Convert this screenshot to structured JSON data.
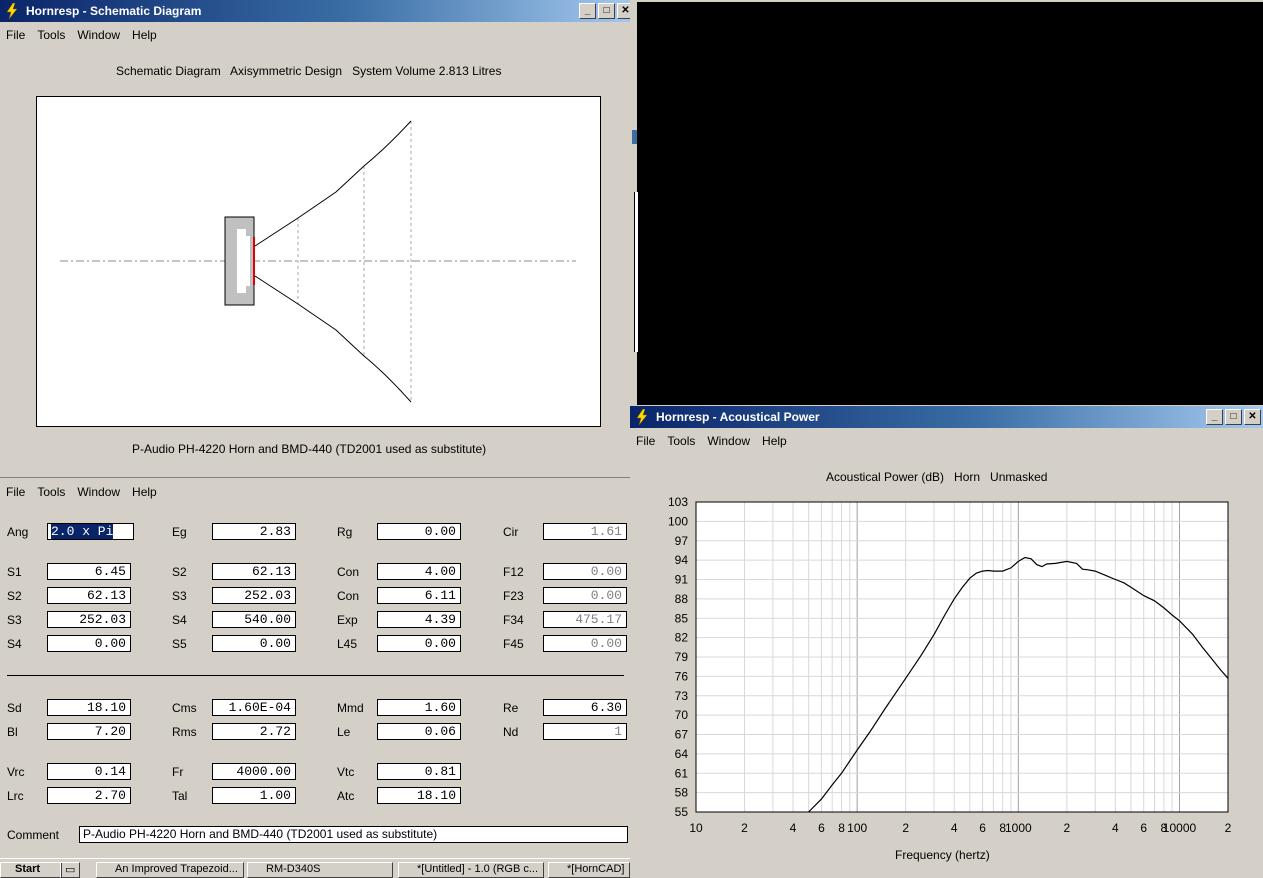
{
  "schematic_window": {
    "title": "Hornresp - Schematic Diagram",
    "menu": [
      "File",
      "Tools",
      "Window",
      "Help"
    ],
    "heading": "Schematic Diagram   Axisymmetric Design   System Volume 2.813 Litres",
    "caption": "P-Audio PH-4220 Horn and BMD-440 (TD2001 used as substitute)"
  },
  "param_window": {
    "menu": [
      "File",
      "Tools",
      "Window",
      "Help"
    ],
    "rows": [
      {
        "label": "Ang",
        "value": "2.0 x Pi"
      },
      {
        "label": "Eg",
        "value": "2.83"
      },
      {
        "label": "Rg",
        "value": "0.00"
      },
      {
        "label": "Cir",
        "value": "1.61"
      },
      {
        "label": "S1",
        "value": "6.45"
      },
      {
        "label": "S2",
        "value": "62.13"
      },
      {
        "label": "Con",
        "value": "4.00"
      },
      {
        "label": "F12",
        "value": "0.00"
      },
      {
        "label": "S2",
        "value": "62.13"
      },
      {
        "label": "S3",
        "value": "252.03"
      },
      {
        "label": "Con",
        "value": "6.11"
      },
      {
        "label": "F23",
        "value": "0.00"
      },
      {
        "label": "S3",
        "value": "252.03"
      },
      {
        "label": "S4",
        "value": "540.00"
      },
      {
        "label": "Exp",
        "value": "4.39"
      },
      {
        "label": "F34",
        "value": "475.17"
      },
      {
        "label": "S4",
        "value": "0.00"
      },
      {
        "label": "S5",
        "value": "0.00"
      },
      {
        "label": "L45",
        "value": "0.00"
      },
      {
        "label": "F45",
        "value": "0.00"
      },
      {
        "label": "Sd",
        "value": "18.10"
      },
      {
        "label": "Cms",
        "value": "1.60E-04"
      },
      {
        "label": "Mmd",
        "value": "1.60"
      },
      {
        "label": "Re",
        "value": "6.30"
      },
      {
        "label": "Bl",
        "value": "7.20"
      },
      {
        "label": "Rms",
        "value": "2.72"
      },
      {
        "label": "Le",
        "value": "0.06"
      },
      {
        "label": "Nd",
        "value": "1"
      },
      {
        "label": "Vrc",
        "value": "0.14"
      },
      {
        "label": "Fr",
        "value": "4000.00"
      },
      {
        "label": "Vtc",
        "value": "0.81"
      },
      {
        "label": "Lrc",
        "value": "2.70"
      },
      {
        "label": "Tal",
        "value": "1.00"
      },
      {
        "label": "Atc",
        "value": "18.10"
      }
    ],
    "comment_label": "Comment",
    "comment_value": "P-Audio PH-4220 Horn and BMD-440 (TD2001 used as substitute)"
  },
  "power_window": {
    "title": "Hornresp - Acoustical Power",
    "menu": [
      "File",
      "Tools",
      "Window",
      "Help"
    ],
    "heading": "Acoustical Power (dB)   Horn   Unmasked",
    "xlabel": "Frequency (hertz)"
  },
  "taskbar": {
    "start": "Start",
    "items": [
      "An Improved Trapezoid...",
      "RM-D340S",
      "*[Untitled] - 1.0 (RGB c...",
      "*[HornCAD]"
    ]
  },
  "chart_data": {
    "type": "line",
    "title": "Acoustical Power (dB)   Horn   Unmasked",
    "xlabel": "Frequency (hertz)",
    "ylabel": "",
    "xscale": "log",
    "xlim": [
      10,
      20000
    ],
    "ylim": [
      55,
      103
    ],
    "yticks": [
      103,
      100,
      97,
      94,
      91,
      88,
      85,
      82,
      79,
      76,
      73,
      70,
      67,
      64,
      61,
      58,
      55
    ],
    "xtick_labels": [
      {
        "f": 10,
        "label": "10"
      },
      {
        "f": 20,
        "label": "2"
      },
      {
        "f": 40,
        "label": "4"
      },
      {
        "f": 60,
        "label": "6"
      },
      {
        "f": 80,
        "label": "8"
      },
      {
        "f": 100,
        "label": "100"
      },
      {
        "f": 200,
        "label": "2"
      },
      {
        "f": 400,
        "label": "4"
      },
      {
        "f": 600,
        "label": "6"
      },
      {
        "f": 800,
        "label": "8"
      },
      {
        "f": 1000,
        "label": "1000"
      },
      {
        "f": 2000,
        "label": "2"
      },
      {
        "f": 4000,
        "label": "4"
      },
      {
        "f": 6000,
        "label": "6"
      },
      {
        "f": 8000,
        "label": "8"
      },
      {
        "f": 10000,
        "label": "10000"
      },
      {
        "f": 20000,
        "label": "2"
      }
    ],
    "grid": true,
    "series": [
      {
        "x": [
          50,
          60,
          70,
          80,
          100,
          120,
          150,
          200,
          250,
          300,
          350,
          400,
          450,
          500,
          550,
          600,
          650,
          700,
          800,
          900,
          1000,
          1100,
          1200,
          1300,
          1400,
          1500,
          1700,
          2000,
          2300,
          2500,
          2700,
          3000,
          3500,
          4000,
          4500,
          5000,
          6000,
          7000,
          8000,
          9000,
          10000,
          12000,
          14000,
          16000,
          18000,
          20000
        ],
        "y": [
          55.0,
          57.0,
          59.2,
          61.0,
          64.6,
          67.4,
          71.1,
          75.7,
          79.3,
          82.5,
          85.5,
          88.0,
          89.8,
          91.2,
          92.0,
          92.3,
          92.4,
          92.3,
          92.3,
          92.8,
          93.8,
          94.4,
          94.2,
          93.3,
          93.0,
          93.4,
          93.5,
          93.8,
          93.5,
          92.6,
          92.5,
          92.3,
          91.6,
          91.0,
          90.5,
          89.8,
          88.5,
          87.7,
          86.6,
          85.5,
          84.6,
          82.6,
          80.4,
          78.6,
          77.0,
          75.7
        ]
      }
    ]
  }
}
